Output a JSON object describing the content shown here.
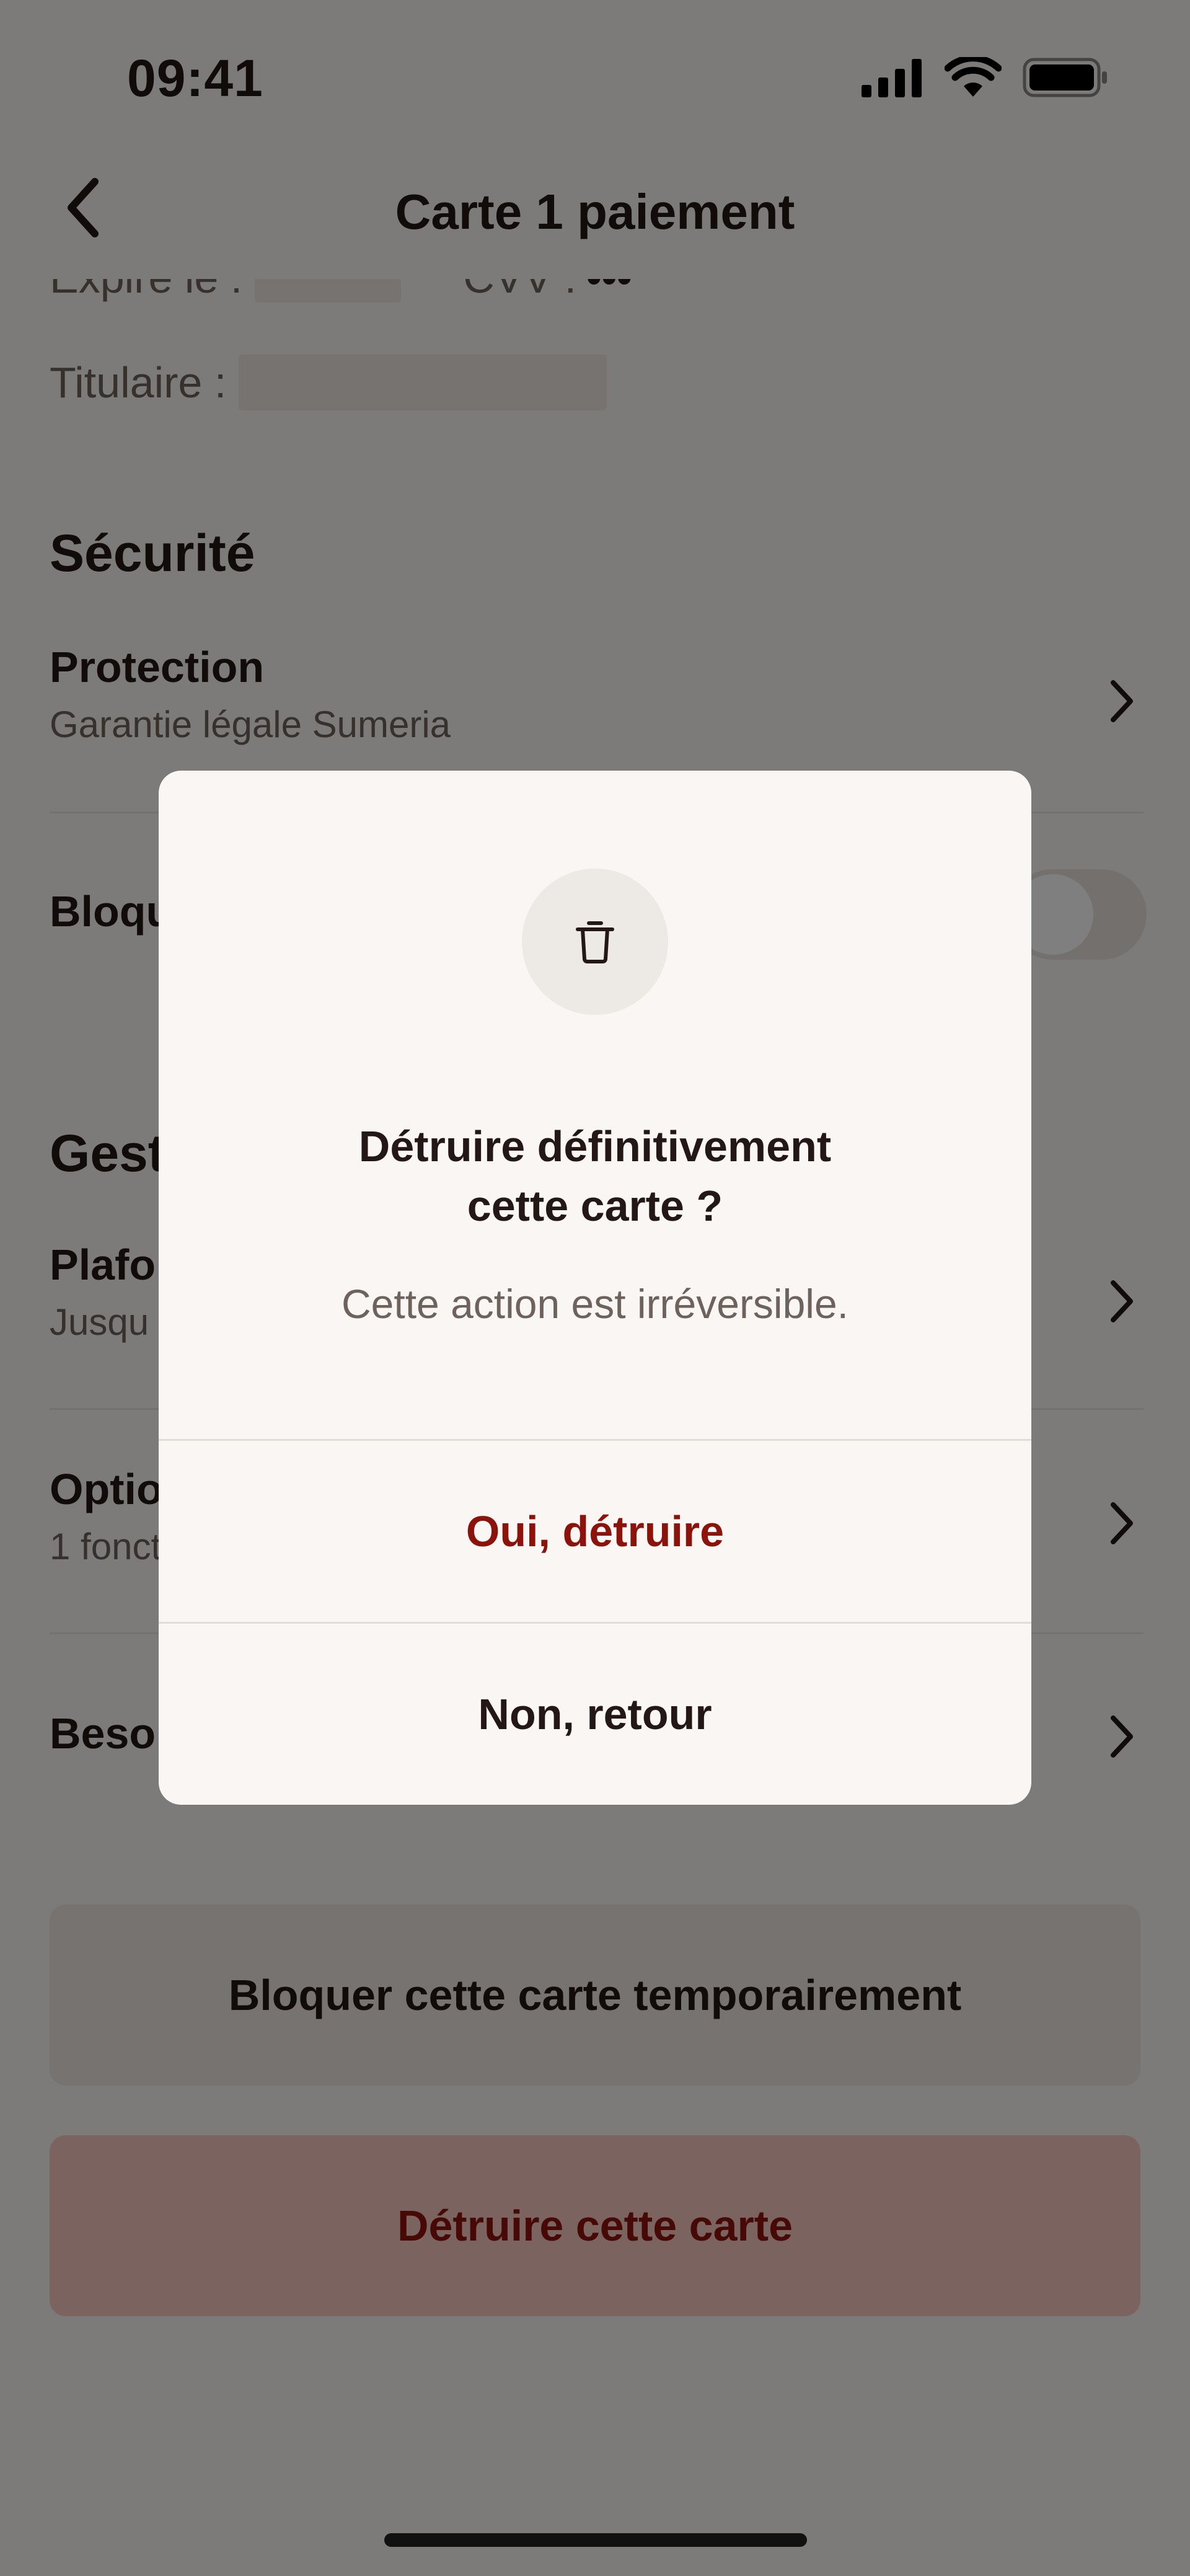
{
  "status_bar": {
    "time": "09:41"
  },
  "header": {
    "title": "Carte 1 paiement"
  },
  "card_details": {
    "expires_label": "Expire le :",
    "cvv_label": "CVV :",
    "cvv_value": "•••",
    "holder_label": "Titulaire :"
  },
  "security_section": {
    "heading": "Sécurité",
    "protection": {
      "title": "Protection",
      "subtitle": "Garantie légale Sumeria"
    },
    "block_row": {
      "title": "Bloqu"
    }
  },
  "management_section": {
    "heading": "Gest",
    "limits": {
      "title": "Plafo",
      "subtitle": "Jusqu"
    },
    "options": {
      "title": "Optio",
      "subtitle": "1 fonct"
    },
    "help": {
      "title": "Beso"
    }
  },
  "buttons": {
    "block_temporarily": "Bloquer cette carte temporairement",
    "destroy": "Détruire cette carte"
  },
  "modal": {
    "icon": "trash-icon",
    "title": "Détruire définitivement\ncette carte ?",
    "message": "Cette action est irréversible.",
    "confirm_label": "Oui, détruire",
    "cancel_label": "Non, retour"
  },
  "colors": {
    "background": "#f9f6f3",
    "destructive": "#8c120c",
    "destroy_button_bg": "#f7c9c0",
    "text_primary": "#231815",
    "text_secondary": "#6e625d"
  }
}
